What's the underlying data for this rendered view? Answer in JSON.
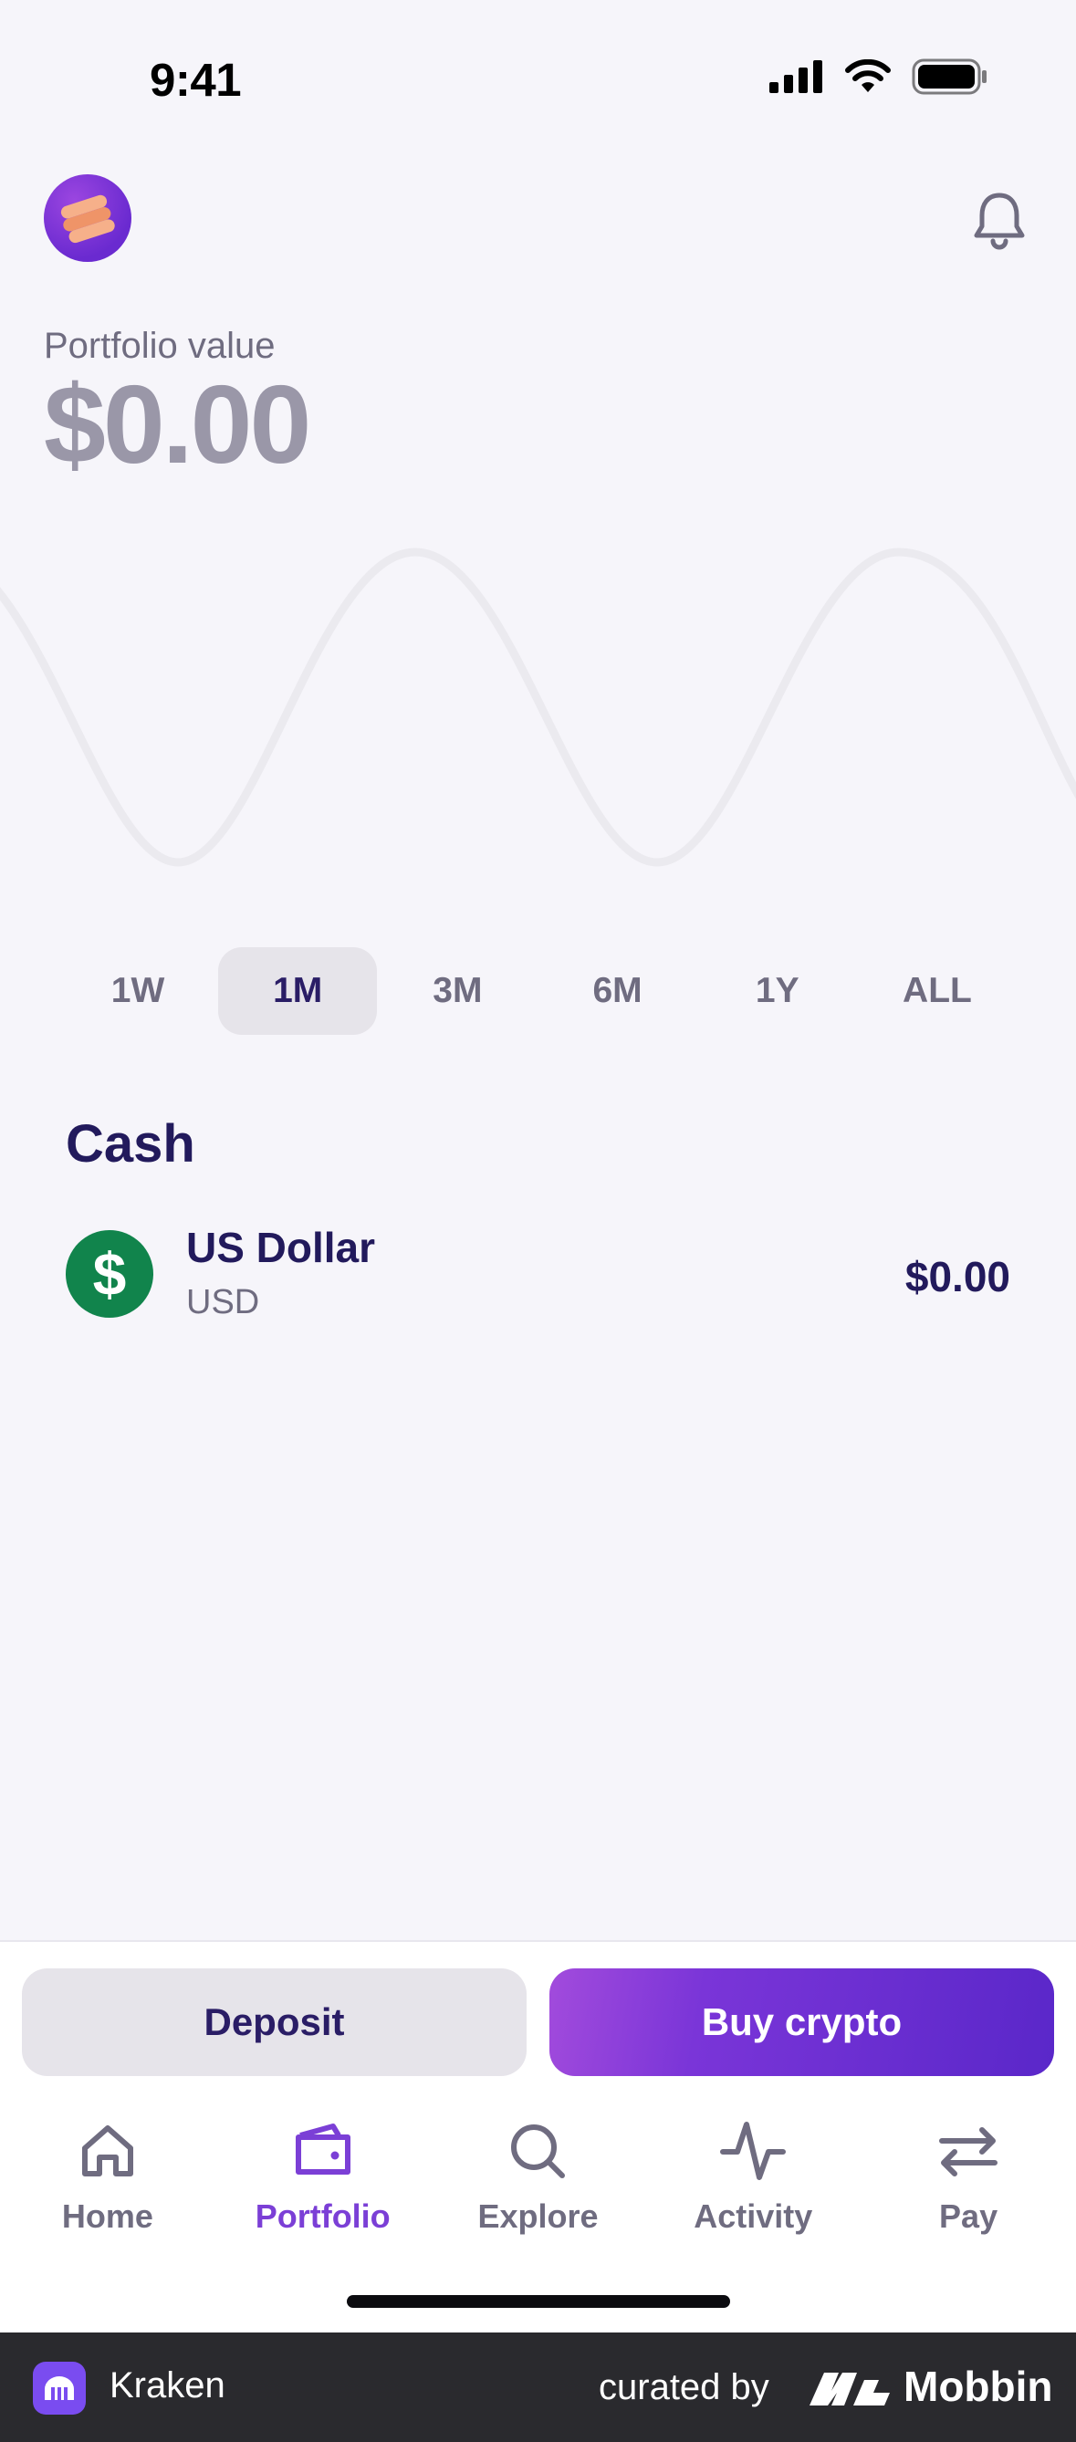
{
  "status_bar": {
    "time": "9:41"
  },
  "portfolio": {
    "label": "Portfolio value",
    "value": "$0.00"
  },
  "ranges": [
    {
      "label": "1W",
      "active": false
    },
    {
      "label": "1M",
      "active": true
    },
    {
      "label": "3M",
      "active": false
    },
    {
      "label": "6M",
      "active": false
    },
    {
      "label": "1Y",
      "active": false
    },
    {
      "label": "ALL",
      "active": false
    }
  ],
  "cash": {
    "title": "Cash",
    "assets": [
      {
        "name": "US Dollar",
        "code": "USD",
        "value": "$0.00",
        "icon": "dollar-icon",
        "icon_glyph": "$",
        "icon_color": "#11844c"
      }
    ]
  },
  "actions": {
    "deposit_label": "Deposit",
    "buy_label": "Buy crypto"
  },
  "tabs": [
    {
      "label": "Home",
      "icon": "home-icon",
      "active": false
    },
    {
      "label": "Portfolio",
      "icon": "wallet-icon",
      "active": true
    },
    {
      "label": "Explore",
      "icon": "search-icon",
      "active": false
    },
    {
      "label": "Activity",
      "icon": "activity-icon",
      "active": false
    },
    {
      "label": "Pay",
      "icon": "transfer-arrows-icon",
      "active": false
    }
  ],
  "footer": {
    "app_name": "Kraken",
    "curated_by": "curated by",
    "brand": "Mobbin"
  },
  "colors": {
    "accent": "#7b3fd6",
    "text_primary": "#221a5c",
    "text_secondary": "#6f6c80",
    "background": "#f6f5fa"
  }
}
